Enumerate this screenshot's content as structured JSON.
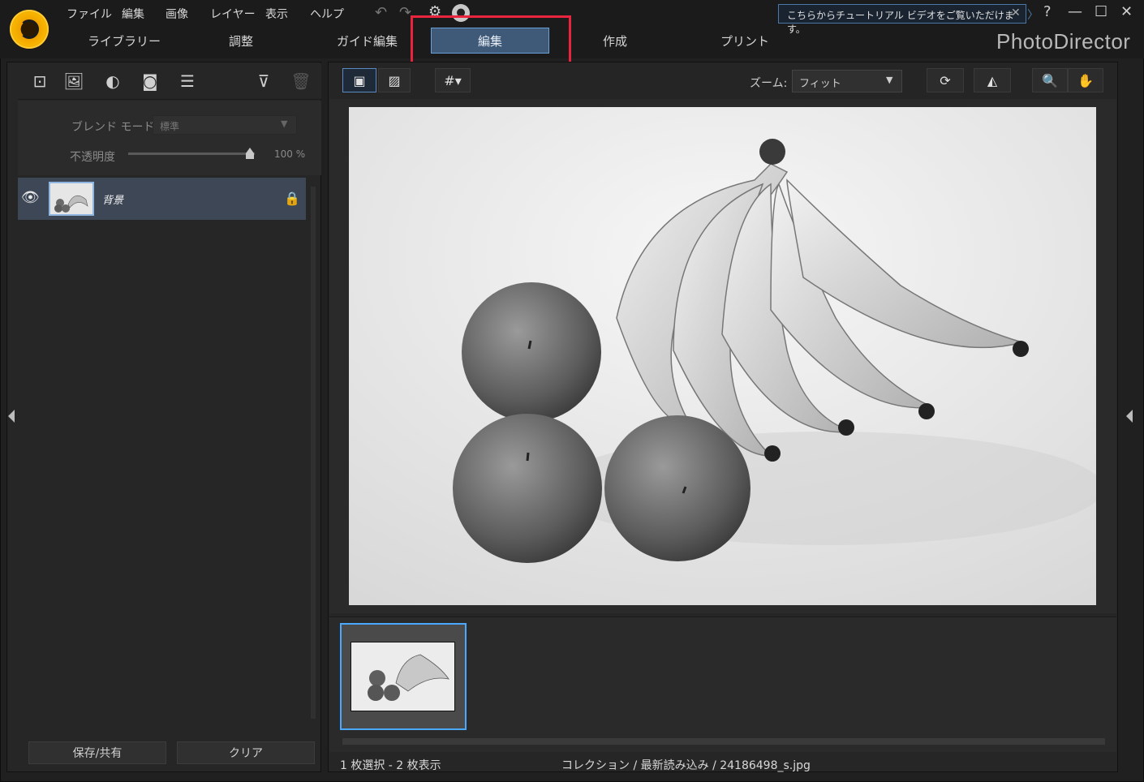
{
  "menu": [
    "ファイル",
    "編集",
    "画像",
    "レイヤー",
    "表示",
    "ヘルプ"
  ],
  "tabs": [
    "ライブラリー",
    "調整",
    "ガイド編集",
    "編集",
    "作成",
    "プリント"
  ],
  "active_tab": "編集",
  "brand": "PhotoDirector",
  "tip": "こちらからチュートリアル ビデオをご覧いただけます。",
  "window": {
    "help": "?",
    "minimize": "—",
    "maximize": "☐",
    "close": "✕"
  },
  "layers_panel": {
    "blend_mode_label": "ブレンド モード:",
    "blend_mode_value": "標準",
    "opacity_label": "不透明度",
    "opacity_value": "100 %",
    "opacity_level": 1.0,
    "layer_name": "背景",
    "save_share": "保存/共有",
    "clear": "クリア"
  },
  "viewer": {
    "zoom_label": "ズーム:",
    "zoom_value": "フィット"
  },
  "status": {
    "selection": "1 枚選択 - 2 枚表示",
    "path": "コレクション / 最新読み込み / 24186498_s.jpg"
  },
  "colors": {
    "accent": "#4aa8ff",
    "highlight_box": "#e8243f",
    "active_tab": "#3f5a78"
  }
}
